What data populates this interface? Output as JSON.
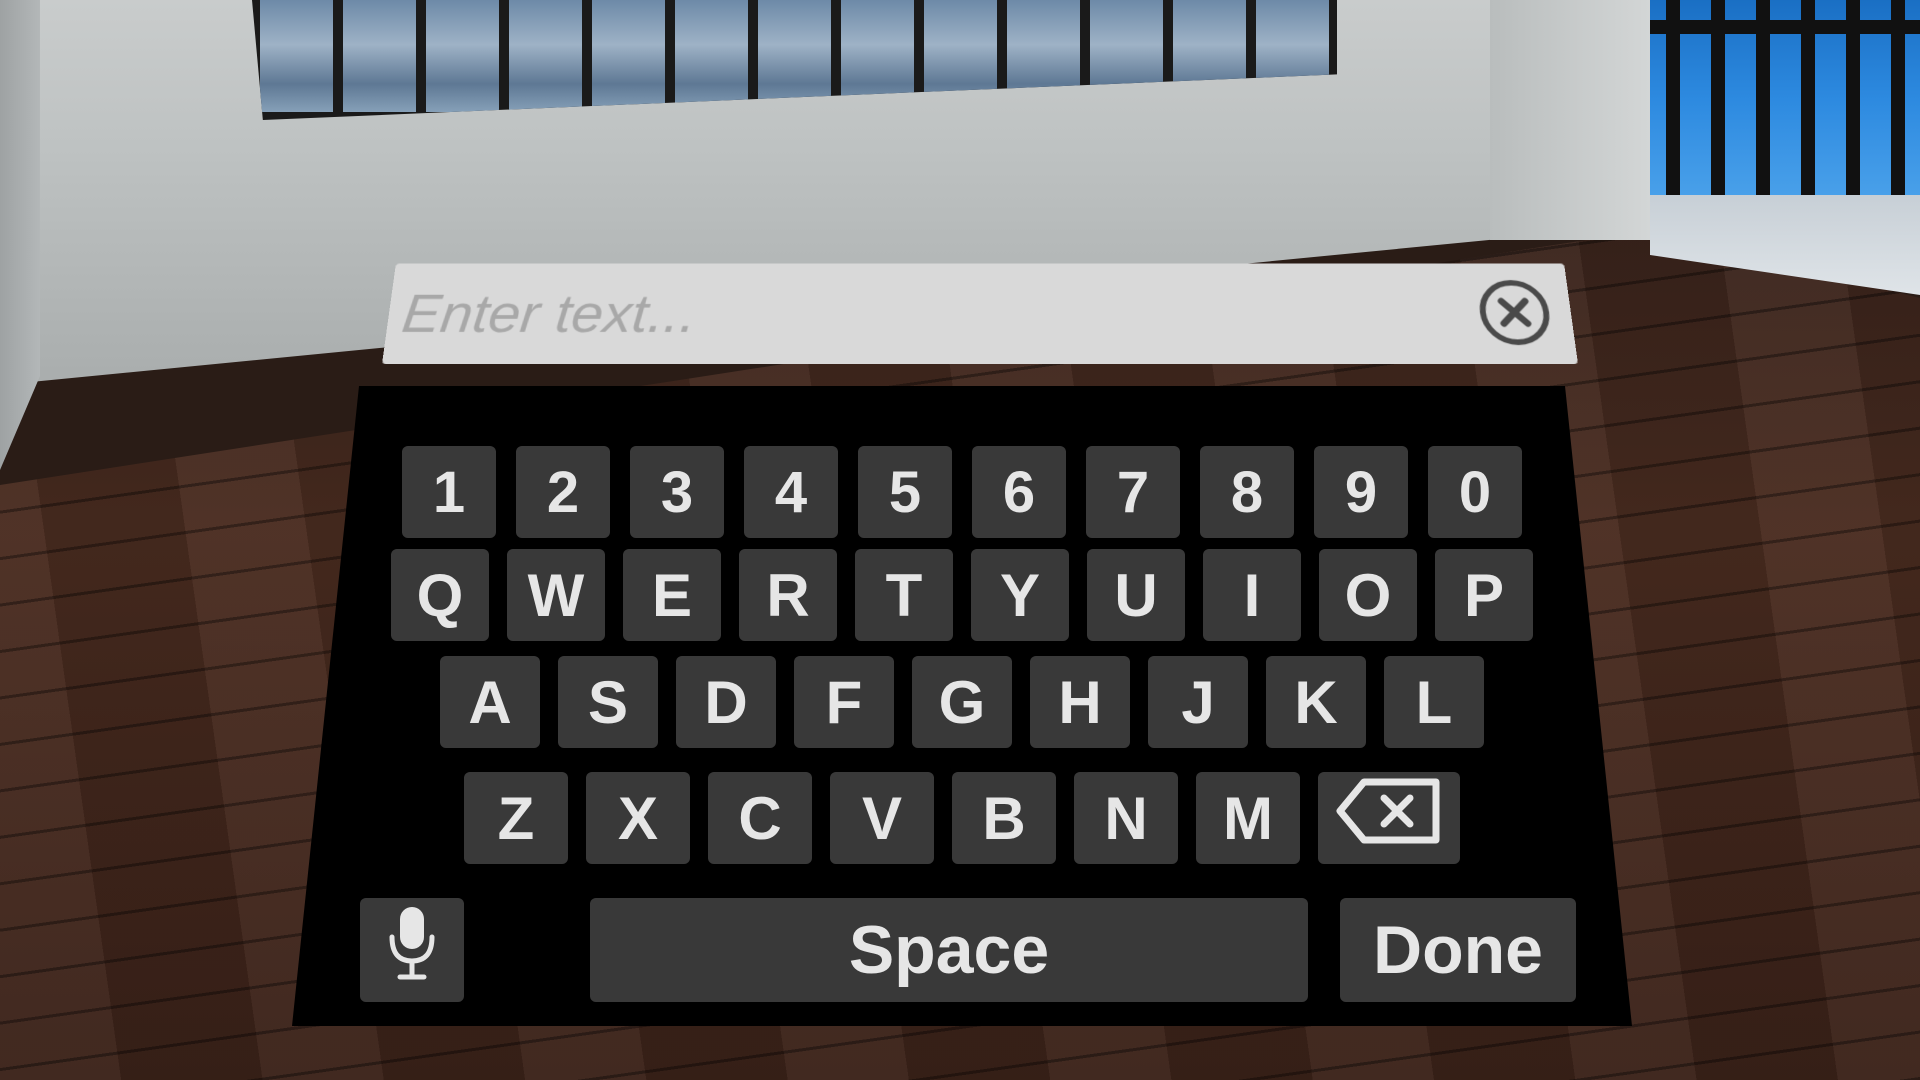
{
  "input": {
    "placeholder": "Enter text...",
    "value": ""
  },
  "icons": {
    "clear": "clear-circle-x-icon",
    "backspace": "backspace-icon",
    "microphone": "microphone-icon"
  },
  "keyboard": {
    "numbers": [
      "1",
      "2",
      "3",
      "4",
      "5",
      "6",
      "7",
      "8",
      "9",
      "0"
    ],
    "row1": [
      "Q",
      "W",
      "E",
      "R",
      "T",
      "Y",
      "U",
      "I",
      "O",
      "P"
    ],
    "row2": [
      "A",
      "S",
      "D",
      "F",
      "G",
      "H",
      "J",
      "K",
      "L"
    ],
    "row3": [
      "Z",
      "X",
      "C",
      "V",
      "B",
      "N",
      "M"
    ],
    "space_label": "Space",
    "done_label": "Done"
  },
  "colors": {
    "key_bg": "#393939",
    "key_text": "#e6e6e6",
    "keyboard_bg": "#000000",
    "input_bg": "#d9d9d9",
    "placeholder": "#a8a8a8"
  }
}
